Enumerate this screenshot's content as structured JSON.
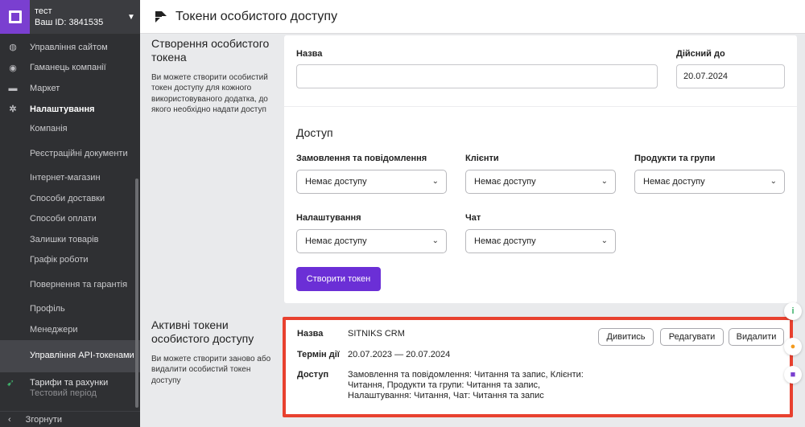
{
  "sidebar": {
    "account_name": "тест",
    "account_id": "Ваш ID: 3841535",
    "items": [
      {
        "label": "Управління сайтом",
        "icon": "globe-icon"
      },
      {
        "label": "Гаманець компанії",
        "icon": "wallet-icon"
      },
      {
        "label": "Маркет",
        "icon": "market-icon"
      },
      {
        "label": "Налаштування",
        "icon": "gear-icon"
      }
    ],
    "sub_items": [
      "Компанія",
      "Реєстраційні документи",
      "Інтернет-магазин",
      "Способи доставки",
      "Способи оплати",
      "Залишки товарів",
      "Графік роботи",
      "Повернення та гарантія",
      "Профіль",
      "Менеджери",
      "Управління API-токенами"
    ],
    "tariff_title": "Тарифи та рахунки",
    "tariff_sub": "Тестовий період",
    "collapse_label": "Згорнути"
  },
  "header": {
    "title": "Токени особистого доступу"
  },
  "create_section": {
    "title": "Створення особистого токена",
    "description": "Ви можете створити особистий токен доступу для кожного використовуваного додатка, до якого необхідно надати доступ",
    "name_label": "Назва",
    "name_value": "",
    "valid_until_label": "Дійсний до",
    "valid_until_value": "20.07.2024",
    "access_heading": "Доступ",
    "access_fields": [
      {
        "label": "Замовлення та повідомлення",
        "value": "Немає доступу"
      },
      {
        "label": "Клієнти",
        "value": "Немає доступу"
      },
      {
        "label": "Продукти та групи",
        "value": "Немає доступу"
      },
      {
        "label": "Налаштування",
        "value": "Немає доступу"
      },
      {
        "label": "Чат",
        "value": "Немає доступу"
      }
    ],
    "create_button": "Створити токен"
  },
  "active_section": {
    "title": "Активні токени особистого доступу",
    "description": "Ви можете створити заново або видалити особистий токен доступу",
    "token": {
      "name_label": "Назва",
      "name_value": "SITNIKS CRM",
      "term_label": "Термін дії",
      "term_value": "20.07.2023 — 20.07.2024",
      "access_label": "Доступ",
      "access_line1": "Замовлення та повідомлення: Читання та запис, Клієнти:",
      "access_line2": "Читання, Продукти та групи: Читання та запис,",
      "access_line3": "Налаштування: Читання, Чат: Читання та запис"
    },
    "view_button": "Дивитись",
    "edit_button": "Редагувати",
    "delete_button": "Видалити"
  },
  "colors": {
    "accent": "#6b2fd6",
    "highlight_border": "#e8412f",
    "sidebar_bg": "#2f3033"
  }
}
